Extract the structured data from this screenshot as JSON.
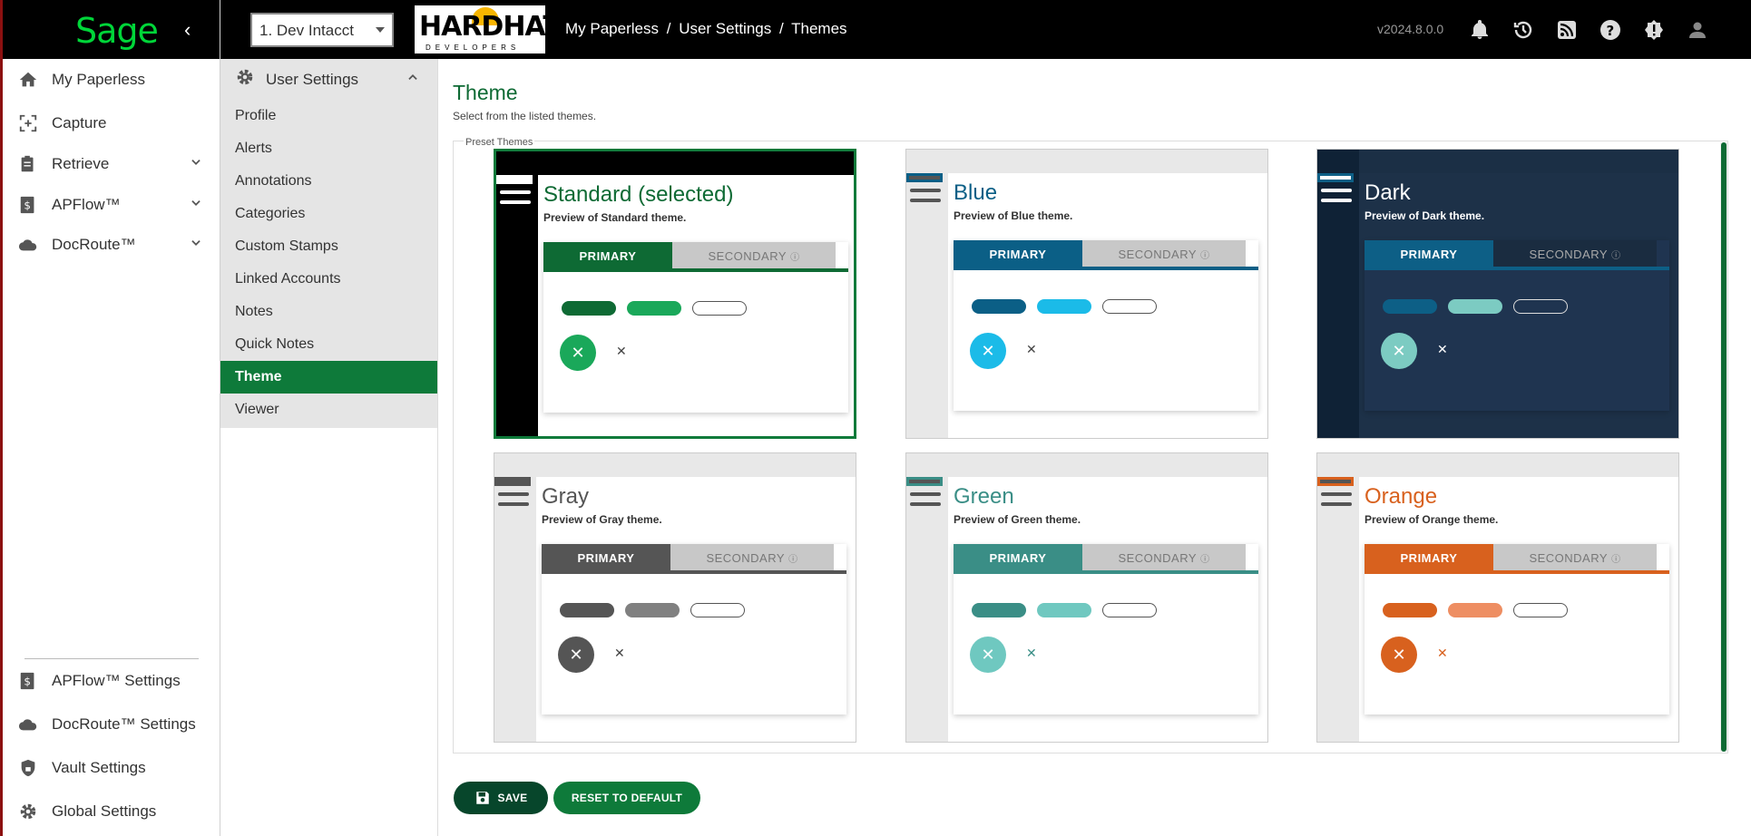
{
  "app": {
    "logo_text": "Sage",
    "brand_color": "#00d639",
    "accent": "#0e7a3a"
  },
  "rail": {
    "items": [
      {
        "label": "My Paperless",
        "icon": "home-icon"
      },
      {
        "label": "Capture",
        "icon": "capture-icon"
      },
      {
        "label": "Retrieve",
        "icon": "clipboard-icon"
      },
      {
        "label": "APFlow™",
        "icon": "dollar-doc-icon"
      },
      {
        "label": "DocRoute™",
        "icon": "cloud-icon"
      }
    ],
    "bottom_items": [
      {
        "label": "APFlow™ Settings",
        "icon": "dollar-doc-icon"
      },
      {
        "label": "DocRoute™ Settings",
        "icon": "cloud-icon"
      },
      {
        "label": "Vault Settings",
        "icon": "shield-lock-icon"
      },
      {
        "label": "Global Settings",
        "icon": "gear-icon"
      }
    ]
  },
  "topbar": {
    "tenant": "1. Dev Intacct",
    "logo_main": "HARDHAT",
    "logo_sub": "DEVELOPERS",
    "breadcrumb": [
      "My Paperless",
      "/",
      "User Settings",
      "/",
      "Themes"
    ],
    "version": "v2024.8.0.0",
    "icons": [
      "bell-icon",
      "history-icon",
      "rss-icon",
      "help-icon",
      "alert-icon",
      "user-icon"
    ]
  },
  "setnav": {
    "header": "User Settings",
    "items": [
      "Profile",
      "Alerts",
      "Annotations",
      "Categories",
      "Custom Stamps",
      "Linked Accounts",
      "Notes",
      "Quick Notes",
      "Theme",
      "Viewer"
    ],
    "active": "Theme"
  },
  "main": {
    "title": "Theme",
    "subtitle": "Select from the listed themes.",
    "legend": "Preset Themes",
    "primary_label": "PRIMARY",
    "secondary_label": "SECONDARY",
    "themes": [
      {
        "name": "Standard (selected)",
        "desc": "Preview of Standard theme.",
        "primary": "#0e6a34",
        "secondary": "#1aa85a",
        "title_color": "#0e6a34"
      },
      {
        "name": "Blue",
        "desc": "Preview of Blue theme.",
        "primary": "#0b5f86",
        "secondary": "#1bbbe8",
        "title_color": "#0b5f86"
      },
      {
        "name": "Dark",
        "desc": "Preview of Dark theme.",
        "primary": "#0d5f86",
        "secondary": "#7ccbc2",
        "title_color": "#ffffff"
      },
      {
        "name": "Gray",
        "desc": "Preview of Gray theme.",
        "primary": "#555555",
        "secondary": "#808080",
        "title_color": "#555555"
      },
      {
        "name": "Green",
        "desc": "Preview of Green theme.",
        "primary": "#3a8e86",
        "secondary": "#6fc8c0",
        "title_color": "#3a8e86"
      },
      {
        "name": "Orange",
        "desc": "Preview of Orange theme.",
        "primary": "#d8611e",
        "secondary": "#ee8e62",
        "title_color": "#d8611e"
      }
    ],
    "save_label": "SAVE",
    "reset_label": "RESET TO DEFAULT"
  }
}
